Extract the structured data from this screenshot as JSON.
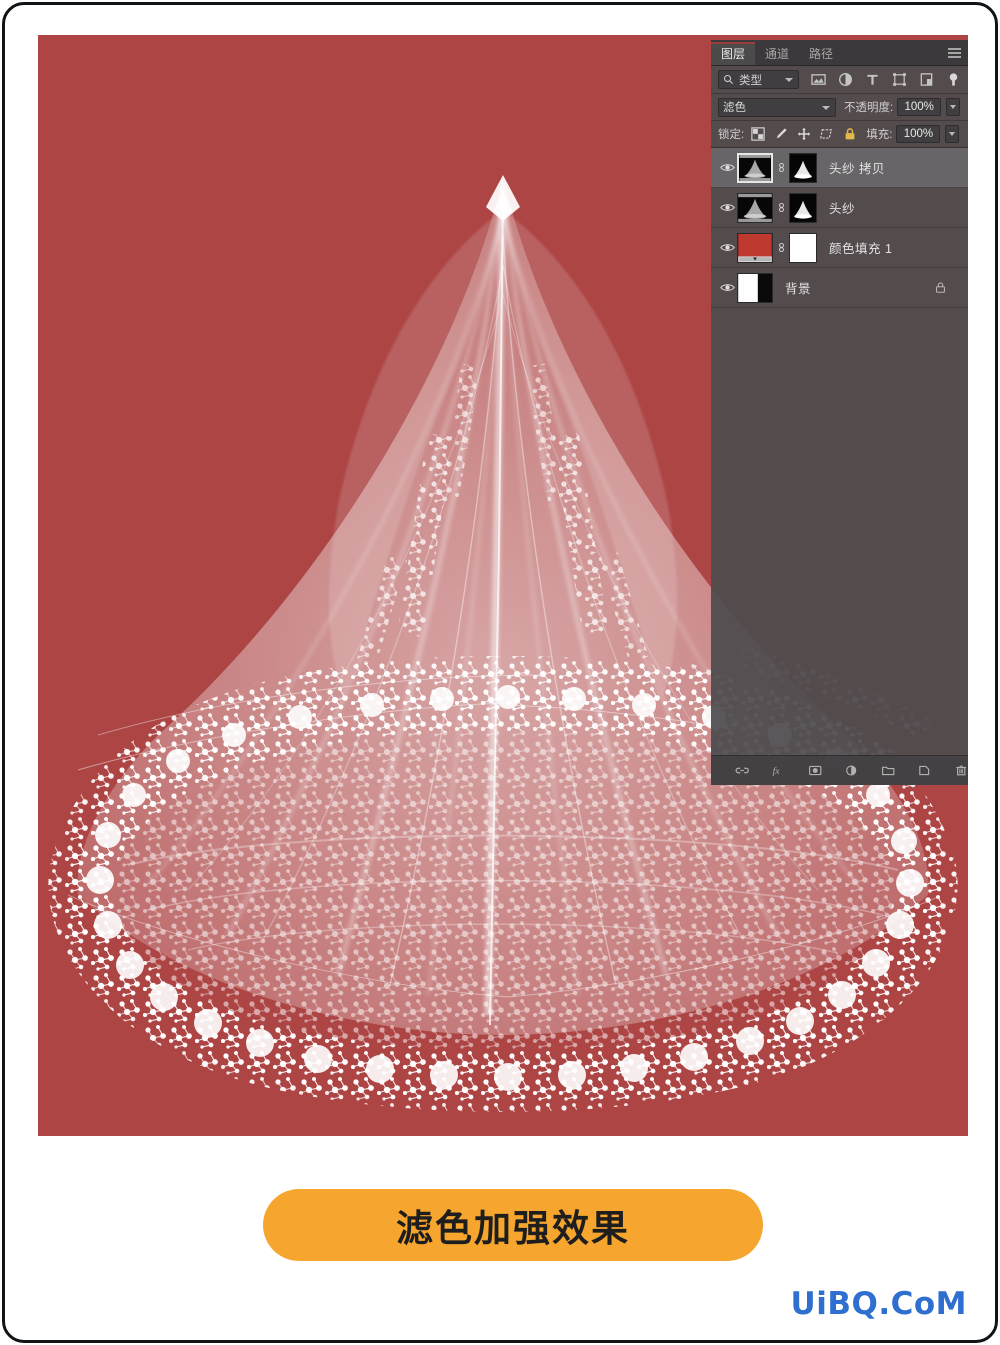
{
  "image": {
    "subject": "bridal-veil-photo",
    "background_color": "#ad4545",
    "veil_color": "#ffffff"
  },
  "panel": {
    "tabs": [
      {
        "label": "图层",
        "active": true
      },
      {
        "label": "通道",
        "active": false
      },
      {
        "label": "路径",
        "active": false
      }
    ],
    "menu_icon": "panel-menu-icon",
    "filter": {
      "search_icon": "search-icon",
      "type_label": "类型",
      "icons": [
        "pixel-layer-filter-icon",
        "adjustment-layer-filter-icon",
        "type-layer-filter-icon",
        "shape-layer-filter-icon",
        "smart-object-filter-icon",
        "filter-toggle-icon"
      ]
    },
    "blend": {
      "mode": "滤色",
      "opacity_label": "不透明度:",
      "opacity_value": "100%"
    },
    "lock": {
      "label": "锁定:",
      "icons": [
        "lock-transparent-pixels-icon",
        "lock-image-pixels-icon",
        "lock-position-icon",
        "lock-artboard-nesting-icon",
        "lock-all-icon"
      ],
      "fill_label": "填充:",
      "fill_value": "100%"
    },
    "layers": [
      {
        "name": "头纱 拷贝",
        "selected": true,
        "visible": true,
        "has_thumb": true,
        "has_link": true,
        "has_mask": true,
        "locked": false
      },
      {
        "name": "头纱",
        "selected": false,
        "visible": true,
        "has_thumb": true,
        "has_link": true,
        "has_mask": true,
        "locked": false
      },
      {
        "name": "颜色填充 1",
        "selected": false,
        "visible": true,
        "has_thumb": true,
        "thumb_color": "#c0392f",
        "has_link": true,
        "has_mask": true,
        "locked": false
      },
      {
        "name": "背景",
        "selected": false,
        "visible": true,
        "has_thumb": true,
        "has_link": false,
        "has_mask": false,
        "locked": true
      }
    ],
    "bottom_icons": [
      "link-layers-icon",
      "layer-style-fx-icon",
      "add-layer-mask-icon",
      "new-adjustment-layer-icon",
      "new-group-icon",
      "new-layer-icon",
      "delete-layer-icon"
    ]
  },
  "cta": {
    "label": "滤色加强效果",
    "background_color": "#f6a52e",
    "text_color": "#1e1e1e"
  },
  "watermark": {
    "text": "UiBQ.CoM",
    "color": "#2f6fd0"
  }
}
